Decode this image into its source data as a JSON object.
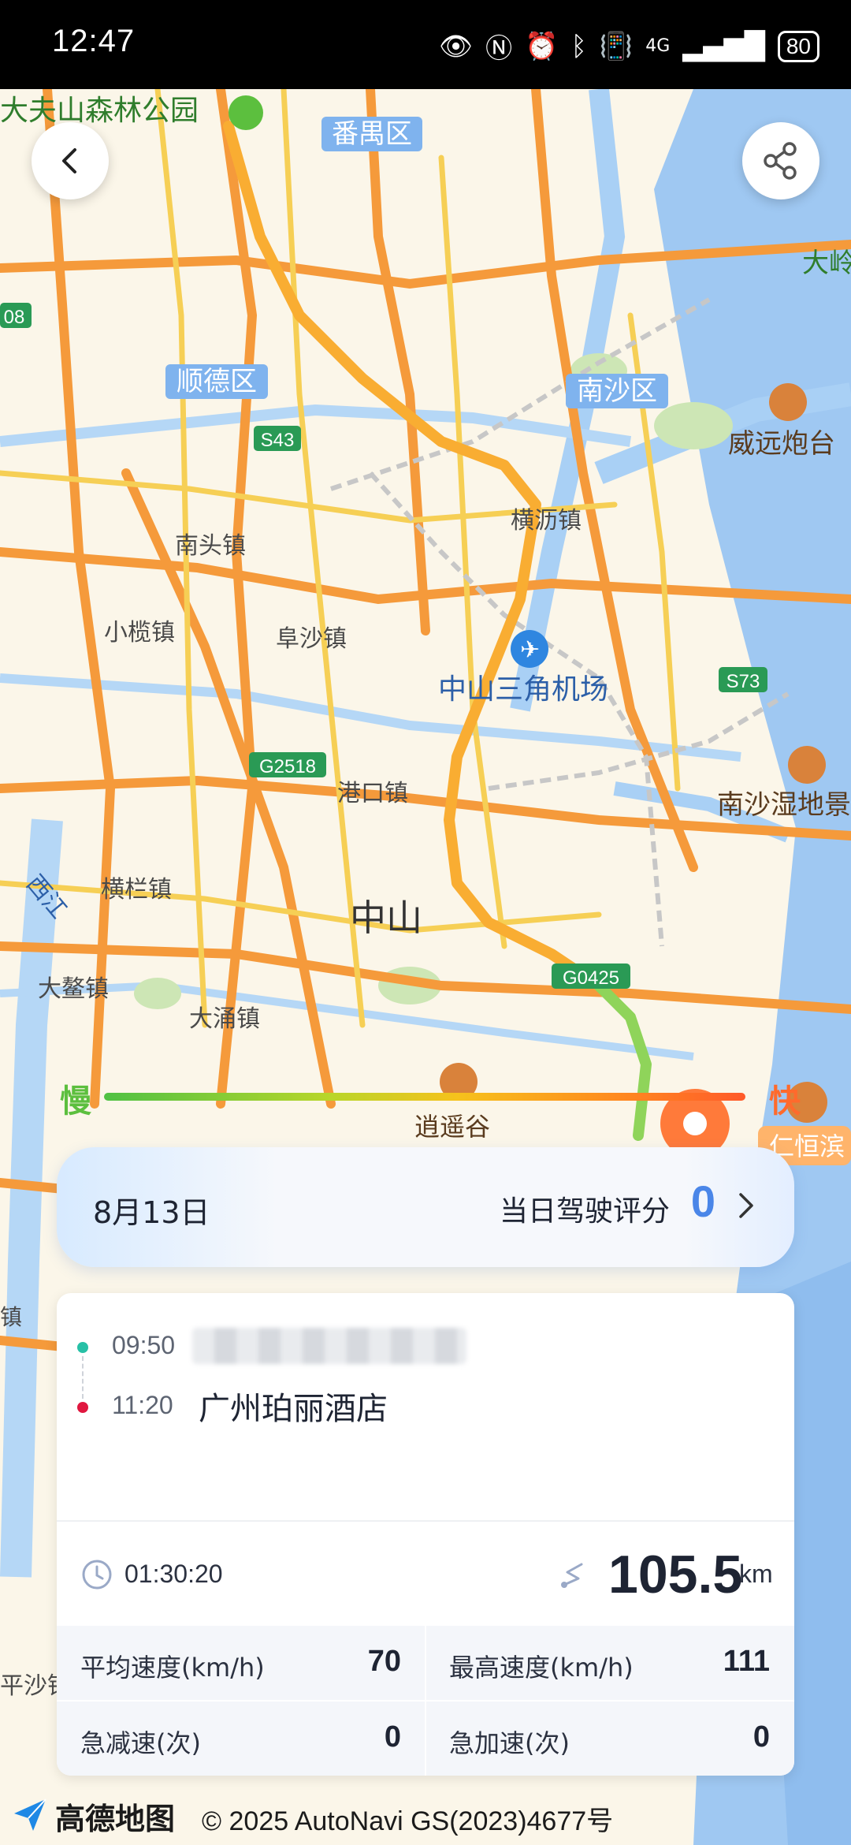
{
  "status_bar": {
    "time": "12:47",
    "network": "4G",
    "battery": "80"
  },
  "map": {
    "labels": {
      "dafushan": "大夫山森林公园",
      "panyu": "番禺区",
      "shunde": "顺德区",
      "nansha": "南沙区",
      "weiyuan": "威远炮台",
      "dalin": "大岭",
      "nantou": "南头镇",
      "hengli": "横沥镇",
      "xiaolan": "小榄镇",
      "fusha": "阜沙镇",
      "airport": "中山三角机场",
      "gangkou": "港口镇",
      "henglan": "横栏镇",
      "zhongshan": "中山",
      "xijiang": "西江",
      "dachong": "大鳌镇",
      "dayong": "大涌镇",
      "xiaoyao": "逍遥谷",
      "nansha_wetland": "南沙湿地景",
      "renheng": "仁恒滨",
      "pingsha": "平沙镇",
      "zhen": "镇"
    },
    "road_shields": {
      "s43": "S43",
      "g2518": "G2518",
      "s73": "S73",
      "g0425": "G0425",
      "edge_08": "08"
    }
  },
  "speed_legend": {
    "slow": "慢",
    "fast": "快"
  },
  "day_summary": {
    "date": "8月13日",
    "score_label": "当日驾驶评分",
    "score": "0"
  },
  "trip": {
    "start_time": "09:50",
    "end_time": "11:20",
    "end_name": "广州珀丽酒店",
    "duration": "01:30:20",
    "distance": "105.5",
    "distance_unit": "km",
    "stats": [
      {
        "label": "平均速度(km/h)",
        "value": "70"
      },
      {
        "label": "最高速度(km/h)",
        "value": "111"
      },
      {
        "label": "急减速(次)",
        "value": "0"
      },
      {
        "label": "急加速(次)",
        "value": "0"
      }
    ]
  },
  "footer": {
    "brand": "高德地图",
    "copyright": "© 2025 AutoNavi  GS(2023)4677号"
  }
}
